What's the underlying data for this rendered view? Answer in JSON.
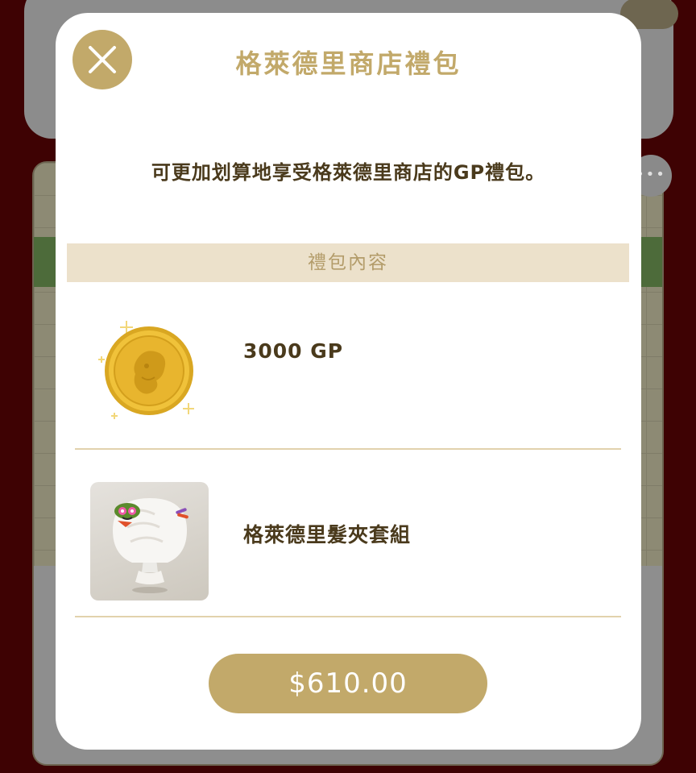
{
  "background": {
    "more_label": "•••"
  },
  "modal": {
    "title": "格萊德里商店禮包",
    "description": "可更加划算地享受格萊德里商店的GP禮包。",
    "section_header": "禮包內容",
    "items": [
      {
        "label": "3000 GP",
        "icon": "gold-coin-icon"
      },
      {
        "label": "格萊德里髮夾套組",
        "icon": "hair-clip-set-icon"
      }
    ],
    "price_label": "$610.00",
    "close_icon": "close-icon"
  },
  "colors": {
    "accent": "#c2a96a",
    "text_dark": "#4a3a1c",
    "section_bg": "#ece1cb",
    "backdrop": "#3e0203"
  }
}
